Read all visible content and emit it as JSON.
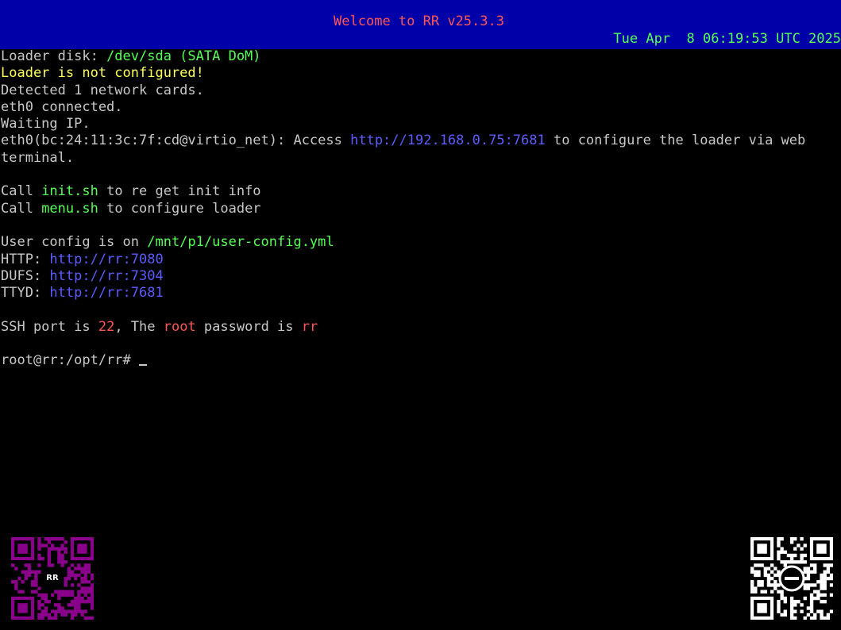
{
  "header": {
    "title": "Welcome to RR v25.3.3",
    "clock": "Tue Apr  8 06:19:53 UTC 2025",
    "background": "#0000a8"
  },
  "terminal": {
    "lines": [
      [
        {
          "t": "Loader disk: ",
          "c": "default"
        },
        {
          "t": "/dev/sda (SATA DoM)",
          "c": "green"
        }
      ],
      [
        {
          "t": "Loader is not configured!",
          "c": "yellow"
        }
      ],
      [
        {
          "t": "Detected 1 network cards.",
          "c": "default"
        }
      ],
      [
        {
          "t": "eth0 connected.",
          "c": "default"
        }
      ],
      [
        {
          "t": "Waiting IP.",
          "c": "default"
        }
      ],
      [
        {
          "t": "eth0(bc:24:11:3c:7f:cd@virtio_net): Access ",
          "c": "default"
        },
        {
          "t": "http://192.168.0.75:7681",
          "c": "blue"
        },
        {
          "t": " to configure the loader via web",
          "c": "default"
        }
      ],
      [
        {
          "t": "terminal.",
          "c": "default"
        }
      ],
      [],
      [
        {
          "t": "Call ",
          "c": "default"
        },
        {
          "t": "init.sh",
          "c": "green"
        },
        {
          "t": " to re get init info",
          "c": "default"
        }
      ],
      [
        {
          "t": "Call ",
          "c": "default"
        },
        {
          "t": "menu.sh",
          "c": "green"
        },
        {
          "t": " to configure loader",
          "c": "default"
        }
      ],
      [],
      [
        {
          "t": "User config is on ",
          "c": "default"
        },
        {
          "t": "/mnt/p1/user-config.yml",
          "c": "green"
        }
      ],
      [
        {
          "t": "HTTP: ",
          "c": "default"
        },
        {
          "t": "http://rr:7080",
          "c": "blue"
        }
      ],
      [
        {
          "t": "DUFS: ",
          "c": "default"
        },
        {
          "t": "http://rr:7304",
          "c": "blue"
        }
      ],
      [
        {
          "t": "TTYD: ",
          "c": "default"
        },
        {
          "t": "http://rr:7681",
          "c": "blue"
        }
      ],
      [],
      [
        {
          "t": "SSH port is ",
          "c": "default"
        },
        {
          "t": "22",
          "c": "red"
        },
        {
          "t": ", The ",
          "c": "default"
        },
        {
          "t": "root",
          "c": "red"
        },
        {
          "t": " password is ",
          "c": "default"
        },
        {
          "t": "rr",
          "c": "red"
        }
      ],
      [],
      [
        {
          "t": "root@rr:/opt/rr# ",
          "c": "default"
        }
      ]
    ]
  },
  "qr_left": {
    "label": "RR",
    "color": "#8b008b"
  },
  "qr_right": {
    "color": "#ffffff"
  },
  "colors": {
    "default": "#c8c8c8",
    "green": "#55ff55",
    "yellow": "#ffff55",
    "blue": "#5c5cff",
    "red": "#ff5555"
  }
}
